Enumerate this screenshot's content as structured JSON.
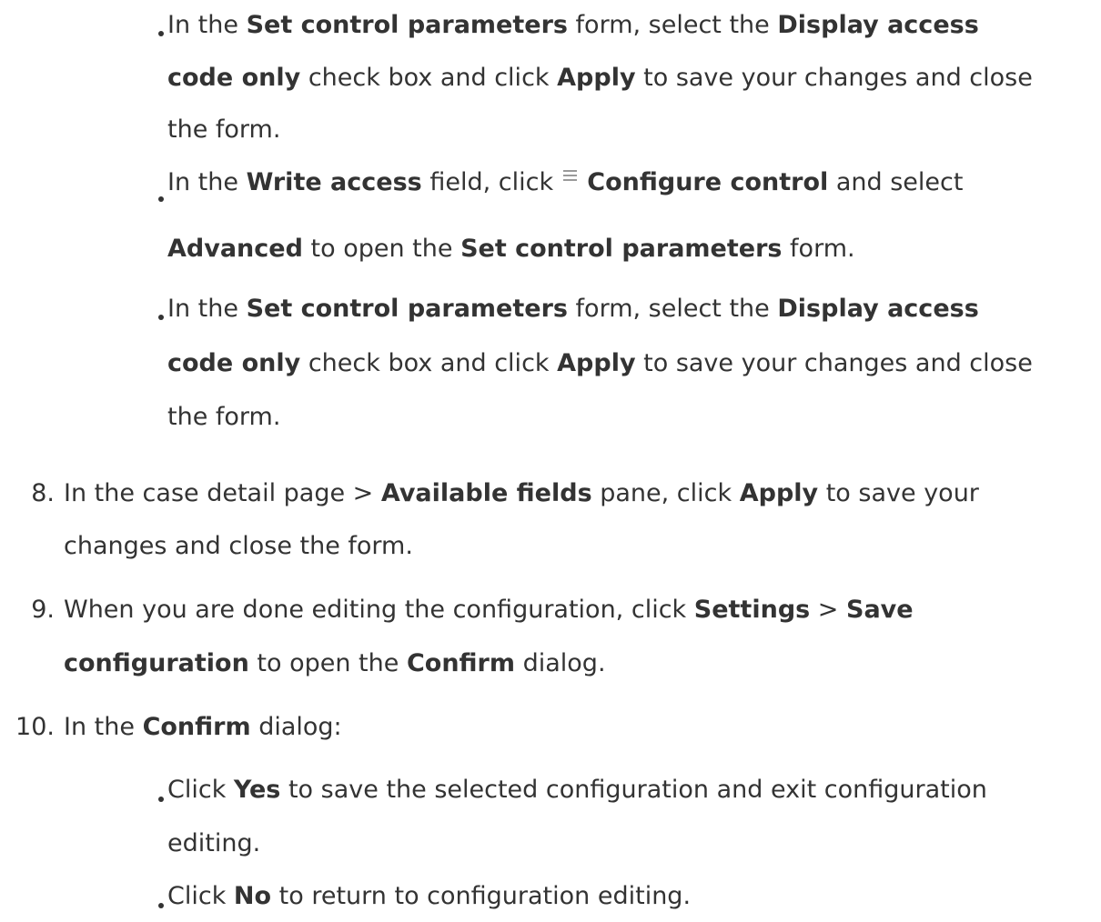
{
  "bullets_top": [
    {
      "lines": [
        [
          {
            "t": "In the "
          },
          {
            "b": "Set control parameters"
          },
          {
            "t": " form, select the "
          },
          {
            "b": "Display access"
          }
        ],
        [
          {
            "b": "code only"
          },
          {
            "t": " check box and click "
          },
          {
            "b": "Apply"
          },
          {
            "t": " to save your changes and close"
          }
        ],
        [
          {
            "t": "the form."
          }
        ]
      ]
    },
    {
      "lines": [
        [
          {
            "t": "In the "
          },
          {
            "b": "Write access"
          },
          {
            "t": " field, click "
          },
          {
            "icon": "configure-control-icon"
          },
          {
            "t": " "
          },
          {
            "b": "Configure control"
          },
          {
            "t": " and select"
          }
        ],
        [
          {
            "b": "Advanced"
          },
          {
            "t": " to open the "
          },
          {
            "b": "Set control parameters"
          },
          {
            "t": " form."
          }
        ]
      ]
    },
    {
      "lines": [
        [
          {
            "t": "In the "
          },
          {
            "b": "Set control parameters"
          },
          {
            "t": " form, select the "
          },
          {
            "b": "Display access"
          }
        ],
        [
          {
            "b": "code only"
          },
          {
            "t": " check box and click "
          },
          {
            "b": "Apply"
          },
          {
            "t": " to save your changes and close"
          }
        ],
        [
          {
            "t": "the form."
          }
        ]
      ]
    }
  ],
  "steps": [
    {
      "number": "8.",
      "lines": [
        [
          {
            "t": "In the case detail page > "
          },
          {
            "b": "Available fields"
          },
          {
            "t": " pane, click "
          },
          {
            "b": "Apply"
          },
          {
            "t": " to save your"
          }
        ],
        [
          {
            "t": "changes and close the form."
          }
        ]
      ]
    },
    {
      "number": "9.",
      "lines": [
        [
          {
            "t": "When you are done editing the configuration, click "
          },
          {
            "b": "Settings"
          },
          {
            "t": " > "
          },
          {
            "b": "Save"
          }
        ],
        [
          {
            "b": "configuration"
          },
          {
            "t": " to open the "
          },
          {
            "b": "Confirm"
          },
          {
            "t": " dialog."
          }
        ]
      ]
    },
    {
      "number": "10.",
      "lines": [
        [
          {
            "t": "In the "
          },
          {
            "b": "Confirm"
          },
          {
            "t": " dialog:"
          }
        ]
      ]
    }
  ],
  "bullets_bottom": [
    {
      "lines": [
        [
          {
            "t": "Click "
          },
          {
            "b": "Yes"
          },
          {
            "t": " to save the selected configuration and exit configuration"
          }
        ],
        [
          {
            "t": "editing."
          }
        ]
      ]
    },
    {
      "lines": [
        [
          {
            "t": "Click "
          },
          {
            "b": "No"
          },
          {
            "t": " to return to configuration editing."
          }
        ]
      ]
    }
  ]
}
